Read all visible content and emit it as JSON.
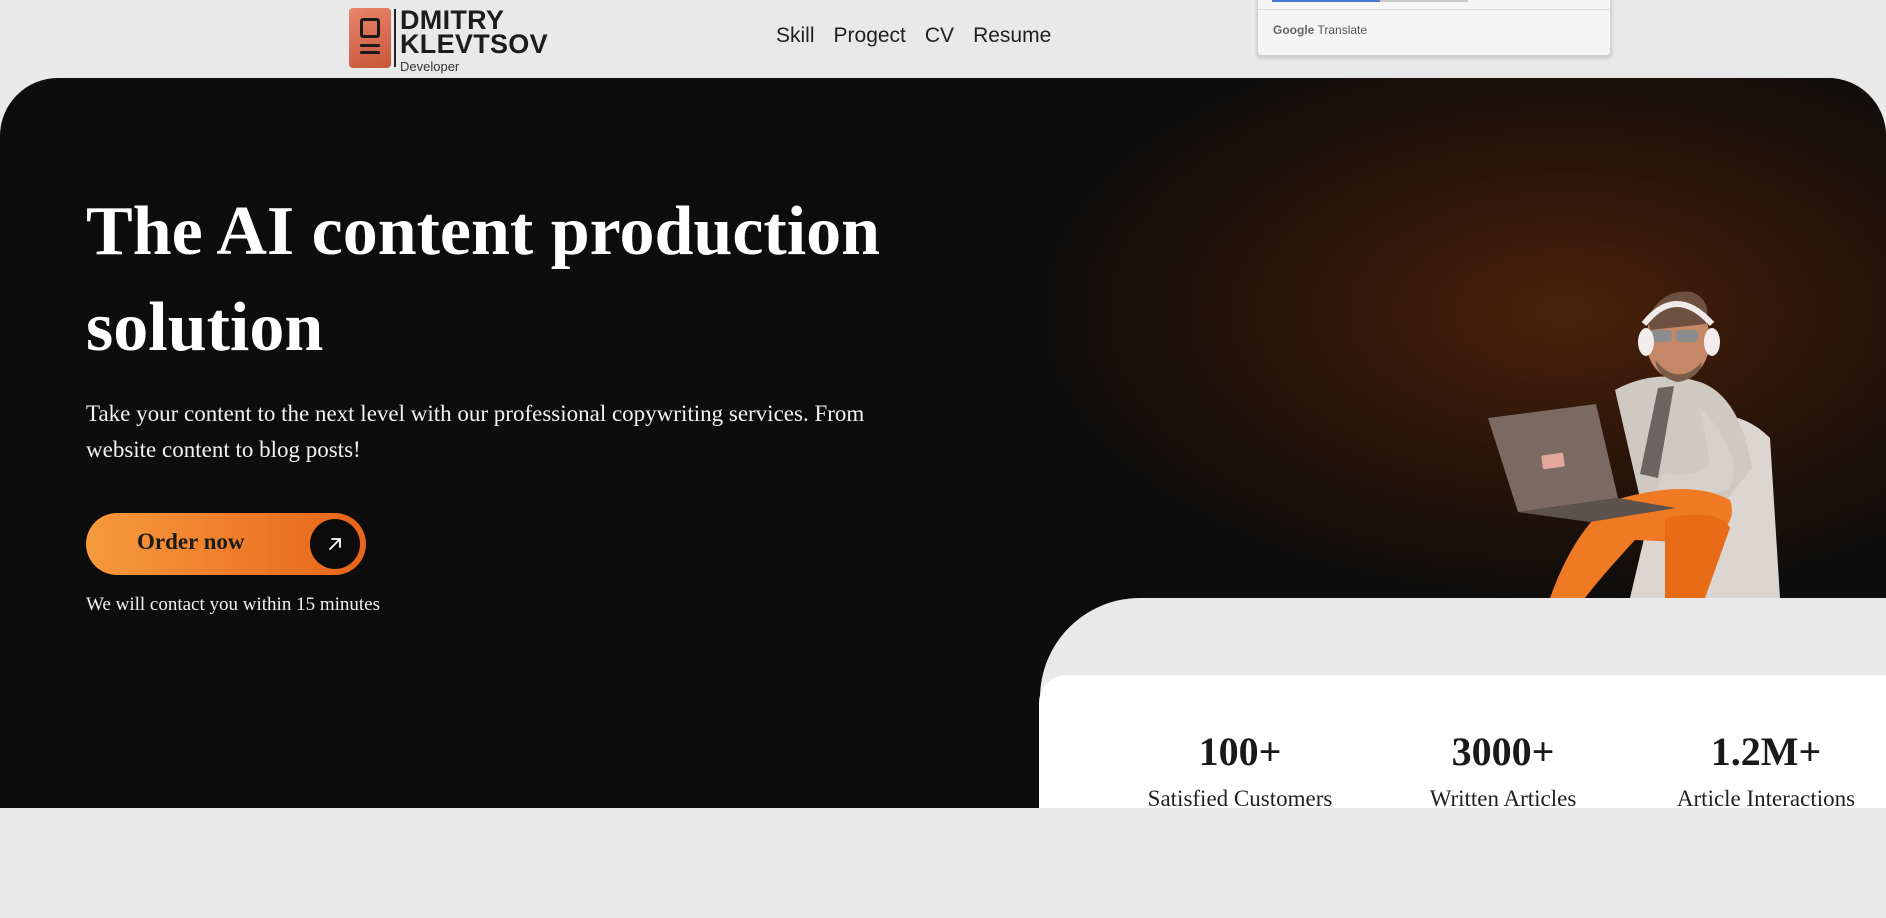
{
  "header": {
    "logo_line1": "DMITRY",
    "logo_line2": "KLEVTSOV",
    "logo_sub": "Developer",
    "nav": [
      "Skill",
      "Progect",
      "CV",
      "Resume"
    ]
  },
  "translate_widget": {
    "brand": "Google",
    "label": "Translate"
  },
  "hero": {
    "title": "The AI content production solution",
    "description": "Take your content to the next level with our professional copywriting services. From website content to blog posts!",
    "order_button": "Order now",
    "contact_note": "We will contact you within 15 minutes"
  },
  "stats": [
    {
      "value": "100+",
      "label": "Satisfied Customers"
    },
    {
      "value": "3000+",
      "label": "Written Articles"
    },
    {
      "value": "1.2M+",
      "label": "Article Interactions"
    }
  ],
  "icons": {
    "logo": "laptop-logo-icon",
    "order_button": "arrow-up-right-icon"
  },
  "colors": {
    "accent_start": "#f79a3e",
    "accent_end": "#e8641a",
    "hero_bg": "#0d0d0d",
    "page_bg": "#e9e9e9"
  }
}
